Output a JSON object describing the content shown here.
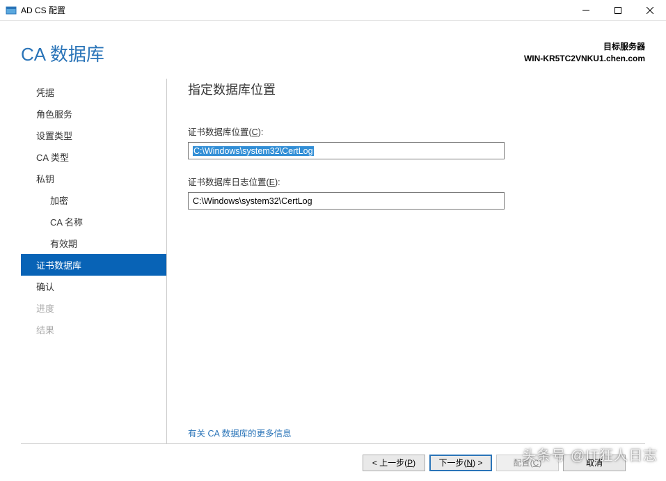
{
  "window": {
    "title": "AD CS 配置"
  },
  "header": {
    "page_title": "CA 数据库",
    "target_label": "目标服务器",
    "target_value": "WIN-KR5TC2VNKU1.chen.com"
  },
  "sidebar": {
    "items": [
      {
        "label": "凭据",
        "indent": 0,
        "selected": false,
        "disabled": false
      },
      {
        "label": "角色服务",
        "indent": 0,
        "selected": false,
        "disabled": false
      },
      {
        "label": "设置类型",
        "indent": 0,
        "selected": false,
        "disabled": false
      },
      {
        "label": "CA 类型",
        "indent": 0,
        "selected": false,
        "disabled": false
      },
      {
        "label": "私钥",
        "indent": 0,
        "selected": false,
        "disabled": false
      },
      {
        "label": "加密",
        "indent": 1,
        "selected": false,
        "disabled": false
      },
      {
        "label": "CA 名称",
        "indent": 1,
        "selected": false,
        "disabled": false
      },
      {
        "label": "有效期",
        "indent": 1,
        "selected": false,
        "disabled": false
      },
      {
        "label": "证书数据库",
        "indent": 0,
        "selected": true,
        "disabled": false
      },
      {
        "label": "确认",
        "indent": 0,
        "selected": false,
        "disabled": false
      },
      {
        "label": "进度",
        "indent": 0,
        "selected": false,
        "disabled": true
      },
      {
        "label": "结果",
        "indent": 0,
        "selected": false,
        "disabled": true
      }
    ]
  },
  "pane": {
    "title": "指定数据库位置",
    "db_location_label_pre": "证书数据库位置(",
    "db_location_label_ak": "C",
    "db_location_label_post": "):",
    "db_location_value": "C:\\Windows\\system32\\CertLog",
    "log_location_label_pre": "证书数据库日志位置(",
    "log_location_label_ak": "E",
    "log_location_label_post": "):",
    "log_location_value": "C:\\Windows\\system32\\CertLog",
    "more_link": "有关 CA 数据库的更多信息"
  },
  "footer": {
    "prev_pre": "< 上一步(",
    "prev_ak": "P",
    "prev_post": ")",
    "next_pre": "下一步(",
    "next_ak": "N",
    "next_post": ") >",
    "configure_pre": "配置(",
    "configure_ak": "C",
    "configure_post": ")",
    "cancel": "取消"
  },
  "watermark": "头条号 @IT狂人日志"
}
